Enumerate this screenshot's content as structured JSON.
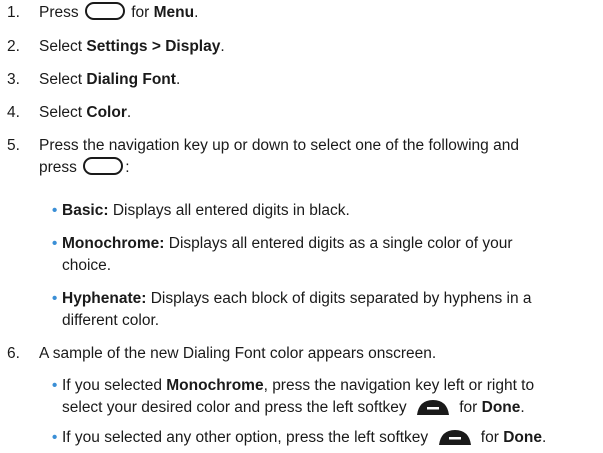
{
  "steps": [
    {
      "num": "1.",
      "pre": "Press ",
      "key": "navigation-key",
      "mid": " for ",
      "bold": "Menu",
      "post": "."
    },
    {
      "num": "2.",
      "pre": "Select ",
      "bold": "Settings > Display",
      "post": "."
    },
    {
      "num": "3.",
      "pre": "Select ",
      "bold": "Dialing Font",
      "post": "."
    },
    {
      "num": "4.",
      "pre": "Select ",
      "bold": "Color",
      "post": "."
    },
    {
      "num": "5.",
      "line1": "Press the navigation key up or down to select one of the following and",
      "line2_pre": "press ",
      "line2_post": ":"
    },
    {
      "num": "6.",
      "text": "A sample of the new Dialing Font color appears onscreen."
    }
  ],
  "options": [
    {
      "bold": "Basic:",
      "text": " Displays all entered digits in black."
    },
    {
      "bold": "Monochrome:",
      "text": " Displays all entered digits as a single color of your",
      "cont": "choice."
    },
    {
      "bold": "Hyphenate:",
      "text": " Displays each block of digits separated by hyphens in a",
      "cont": "different color."
    }
  ],
  "sub6": [
    {
      "pre": "If you selected ",
      "bold": "Monochrome",
      "text": ", press the navigation key left or right to",
      "line2_pre": "select your desired color and press the left softkey ",
      "line2_mid": " for ",
      "line2_bold": "Done",
      "line2_post": "."
    },
    {
      "pre": "If you selected any other option, press the left softkey ",
      "mid": " for ",
      "bold": "Done",
      "post": "."
    }
  ],
  "colors": {
    "bullet": "#3b8fd6",
    "text": "#1a1a1a"
  },
  "icons": {
    "nav_key": "navigation-key-icon",
    "softkey": "left-softkey-icon"
  }
}
